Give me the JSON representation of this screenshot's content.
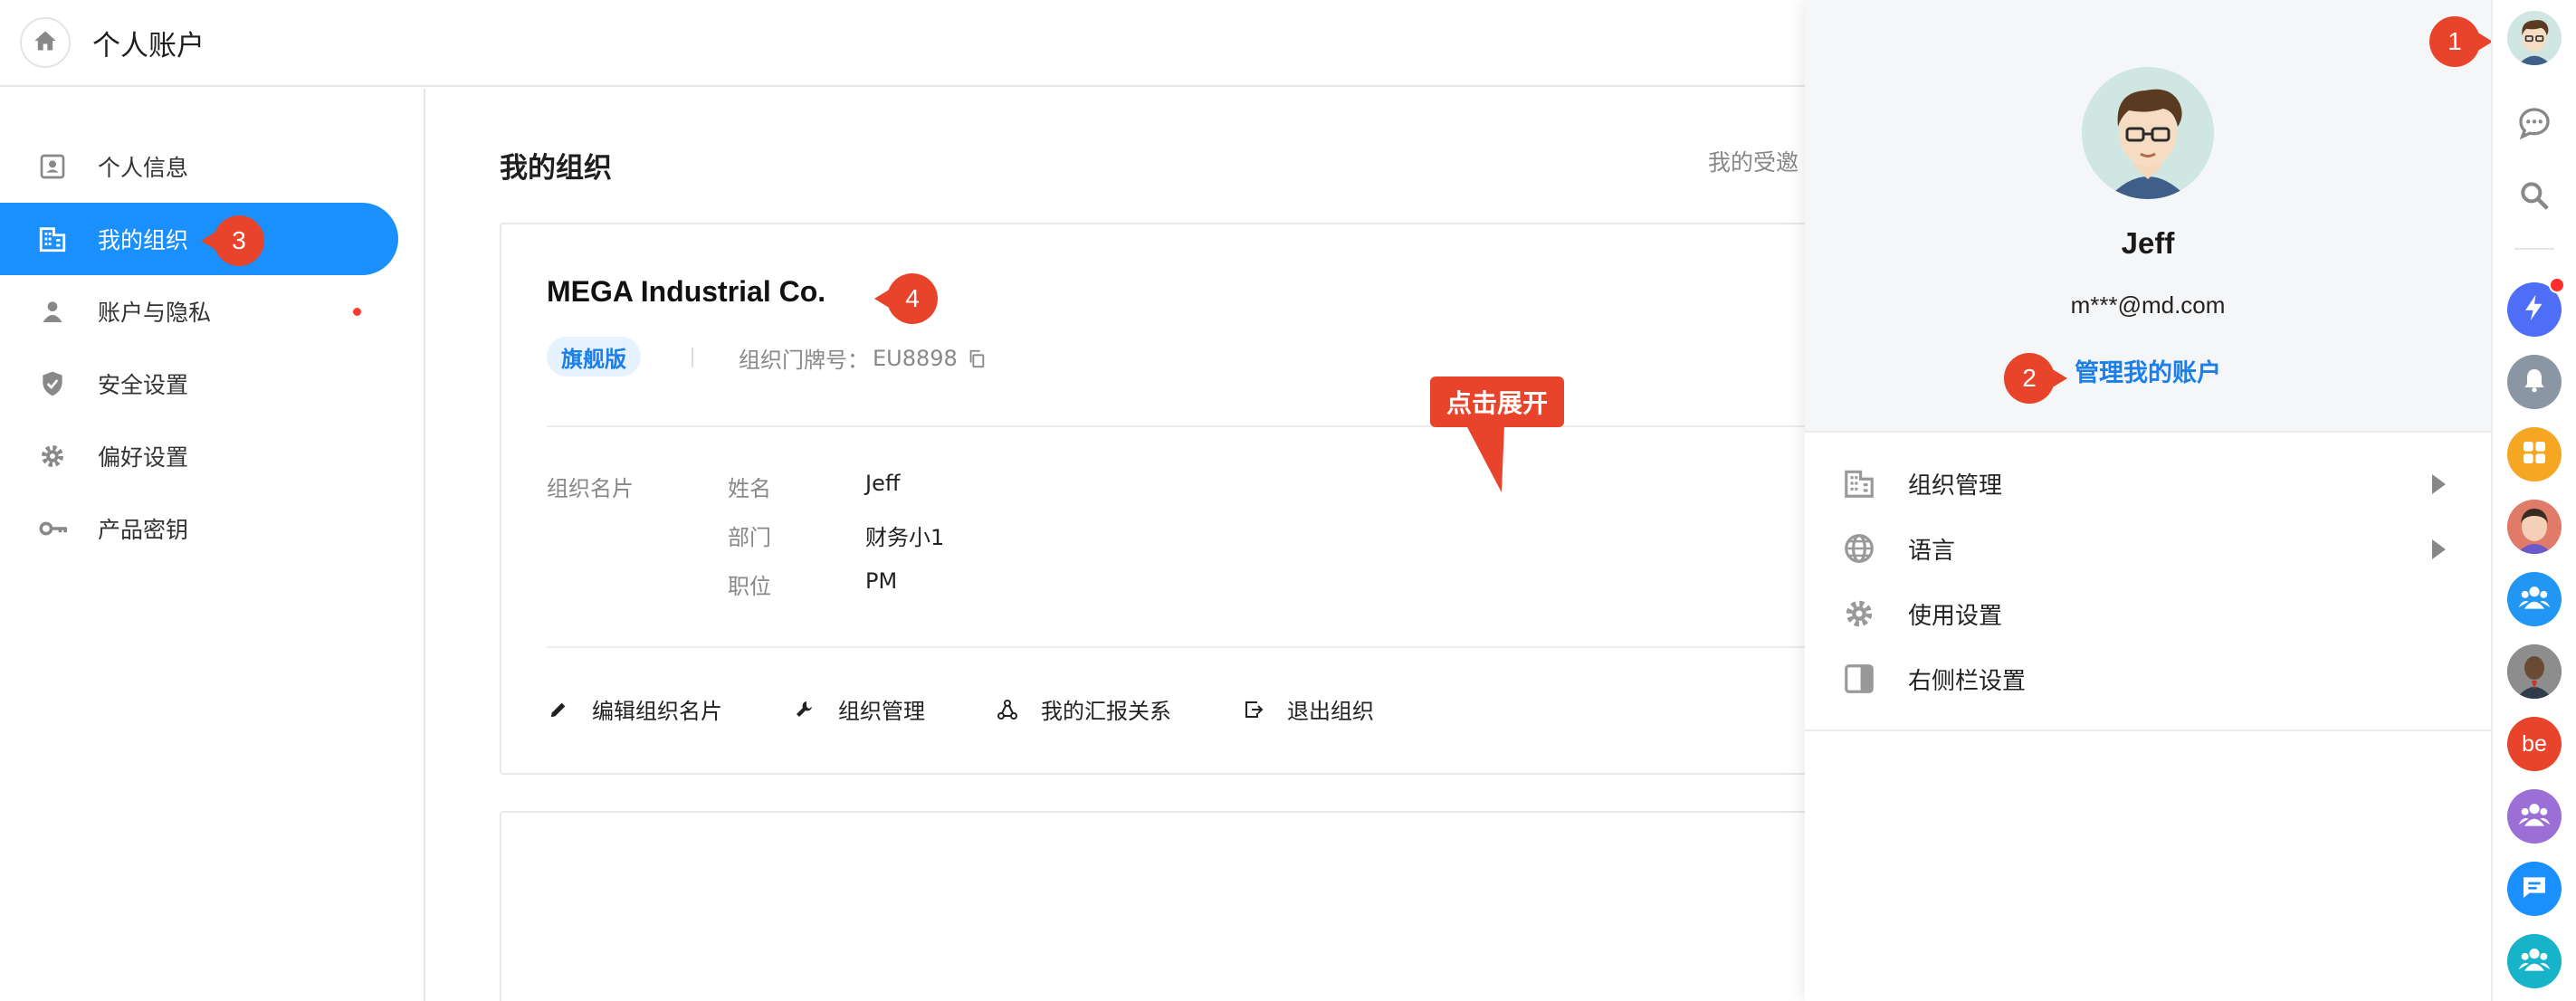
{
  "header": {
    "title": "个人账户",
    "home_icon": "home-icon"
  },
  "sidebar": {
    "items": [
      {
        "label": "个人信息",
        "icon": "id-card-icon"
      },
      {
        "label": "我的组织",
        "icon": "building-icon",
        "active": true
      },
      {
        "label": "账户与隐私",
        "icon": "person-icon",
        "has_dot": true
      },
      {
        "label": "安全设置",
        "icon": "shield-icon"
      },
      {
        "label": "偏好设置",
        "icon": "gear-icon"
      },
      {
        "label": "产品密钥",
        "icon": "key-icon"
      }
    ]
  },
  "main": {
    "section_title": "我的组织",
    "invite_link": "我的受邀",
    "org": {
      "name": "MEGA Industrial Co.",
      "badge": "旗舰版",
      "door_label": "组织门牌号：",
      "door_value": "EU8898",
      "business_card_title": "组织名片",
      "fields": [
        {
          "key": "姓名",
          "value": "Jeff"
        },
        {
          "key": "部门",
          "value": "财务小1"
        },
        {
          "key": "职位",
          "value": "PM"
        }
      ],
      "actions": [
        {
          "label": "编辑组织名片",
          "icon": "pencil-icon"
        },
        {
          "label": "组织管理",
          "icon": "wrench-icon"
        },
        {
          "label": "我的汇报关系",
          "icon": "network-icon"
        },
        {
          "label": "退出组织",
          "icon": "exit-icon"
        }
      ]
    },
    "tooltip": "点击展开"
  },
  "markers": [
    "1",
    "2",
    "3",
    "4"
  ],
  "account_panel": {
    "name": "Jeff",
    "email": "m***@md.com",
    "manage_link": "管理我的账户",
    "menu": [
      {
        "label": "组织管理",
        "icon": "building-icon",
        "has_arrow": true
      },
      {
        "label": "语言",
        "icon": "globe-icon",
        "has_arrow": true
      },
      {
        "label": "使用设置",
        "icon": "gear-icon",
        "has_arrow": false
      },
      {
        "label": "右侧栏设置",
        "icon": "sidebar-panel-icon",
        "has_arrow": false
      }
    ]
  },
  "rail": {
    "avatar_text": "be",
    "colors": {
      "accent": "#1a90ff",
      "marker": "#e8432b",
      "ai": "#4f6ef7",
      "bell": "#8a96a3",
      "apps": "#f5a623",
      "group": "#2196f3",
      "be": "#e8432b",
      "purple": "#9b6fd6",
      "chat": "#1a90ff",
      "teal": "#17b3c9"
    }
  }
}
